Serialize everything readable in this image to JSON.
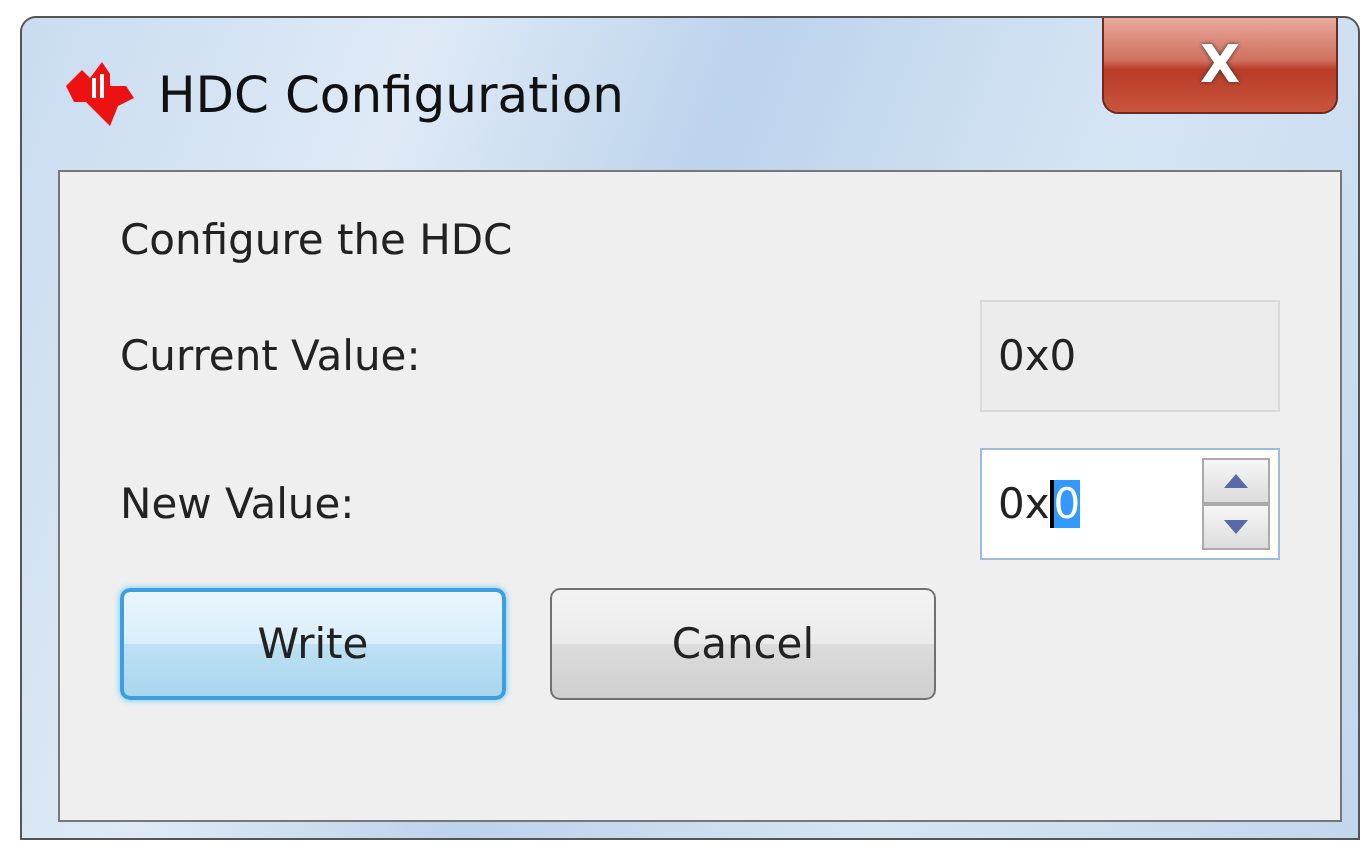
{
  "window": {
    "title": "HDC Configuration",
    "close_label": "X"
  },
  "heading": "Configure the HDC",
  "current_value": {
    "label": "Current Value:",
    "value": "0x0"
  },
  "new_value": {
    "label": "New Value:",
    "value_before": "0x",
    "selected_text": "0"
  },
  "buttons": [
    {
      "label": "Write",
      "default": true
    },
    {
      "label": "Cancel",
      "default": false
    }
  ]
}
